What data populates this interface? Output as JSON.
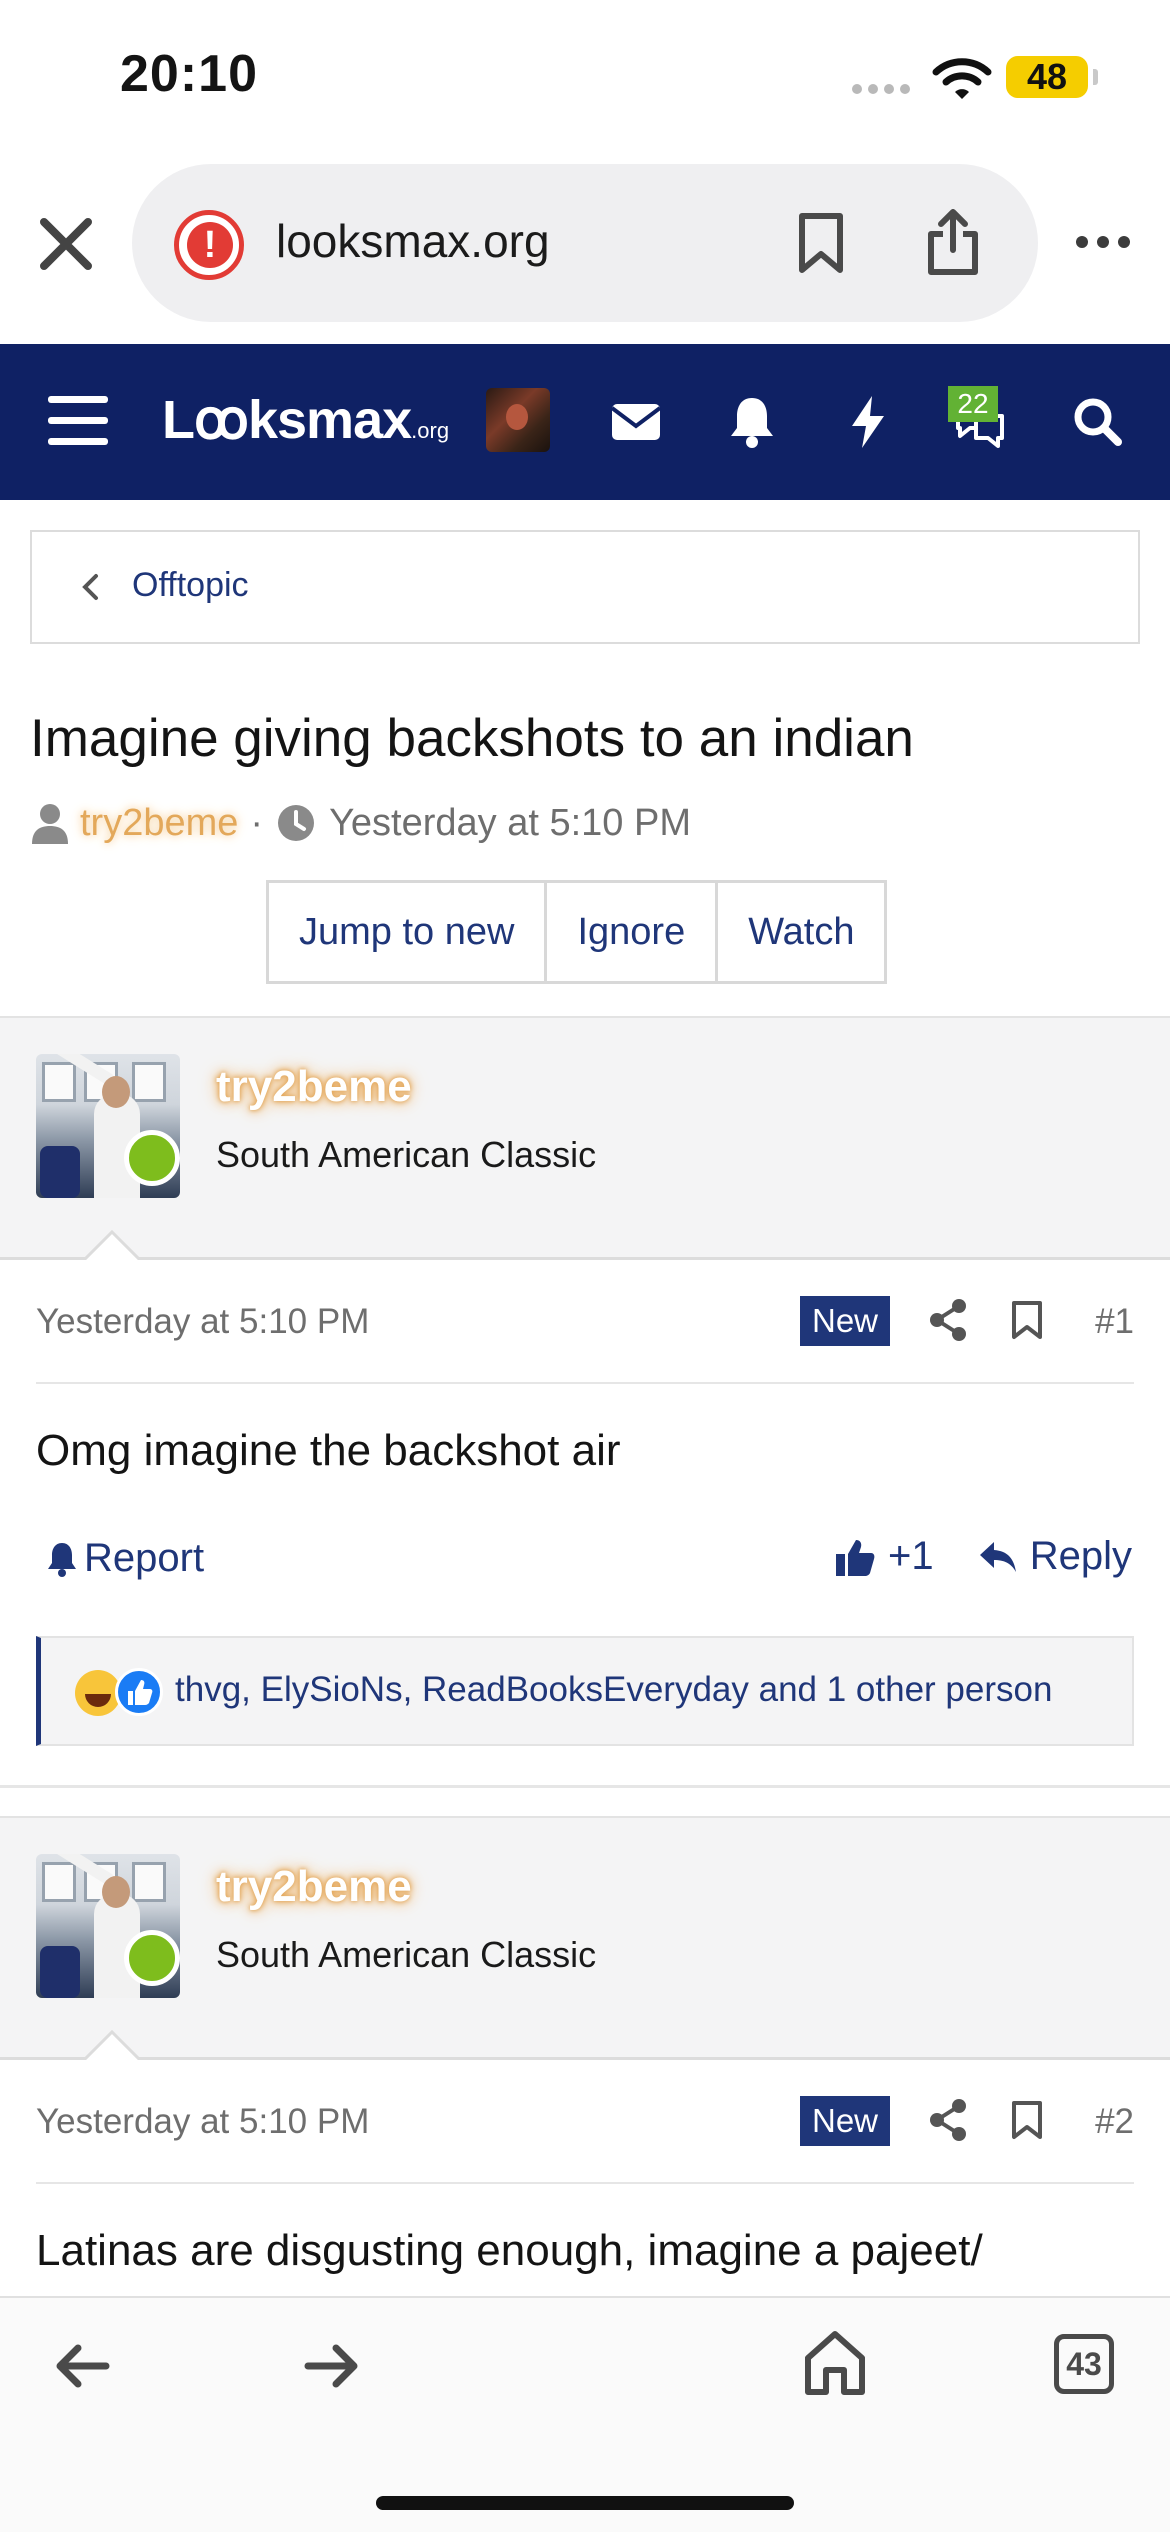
{
  "status_bar": {
    "time": "20:10",
    "battery": "48"
  },
  "browser": {
    "url": "looksmax.org",
    "tab_count": "43"
  },
  "nav": {
    "logo_main": "Lꝏksmax",
    "logo_suffix": ".org",
    "conversations_count": "22"
  },
  "breadcrumb": {
    "label": "Offtopic"
  },
  "thread": {
    "title": "Imagine giving backshots to an indian",
    "author": "try2beme",
    "separator": "·",
    "date": "Yesterday at 5:10 PM",
    "buttons": {
      "jump_to_new": "Jump to new",
      "ignore": "Ignore",
      "watch": "Watch"
    }
  },
  "posts": [
    {
      "username": "try2beme",
      "role": "South American Classic",
      "date": "Yesterday at 5:10 PM",
      "badge": "New",
      "number": "#1",
      "body": "Omg imagine the backshot air",
      "report_label": "Report",
      "like_label": "+1",
      "reply_label": "Reply",
      "reactions_text": "thvg, ElySioNs, ReadBooksEveryday and 1 other person"
    },
    {
      "username": "try2beme",
      "role": "South American Classic",
      "date": "Yesterday at 5:10 PM",
      "badge": "New",
      "number": "#2",
      "body": "Latinas are disgusting enough, imagine a pajeet/"
    }
  ],
  "icons": [
    "close-icon",
    "warning-icon",
    "bookmark-icon",
    "share-icon",
    "more-icon",
    "menu-icon",
    "mail-icon",
    "bell-icon",
    "bolt-icon",
    "chat-icon",
    "search-icon",
    "chevron-left-icon",
    "person-icon",
    "clock-icon",
    "report-bell-icon",
    "thumbs-up-icon",
    "reply-icon",
    "back-icon",
    "forward-icon",
    "home-icon",
    "tabs-icon"
  ],
  "colors": {
    "nav_bg": "#0f2164",
    "link": "#1f3679",
    "online": "#7ebd1d",
    "badge_green": "#62b234",
    "username_glow": "#e3a85a"
  }
}
